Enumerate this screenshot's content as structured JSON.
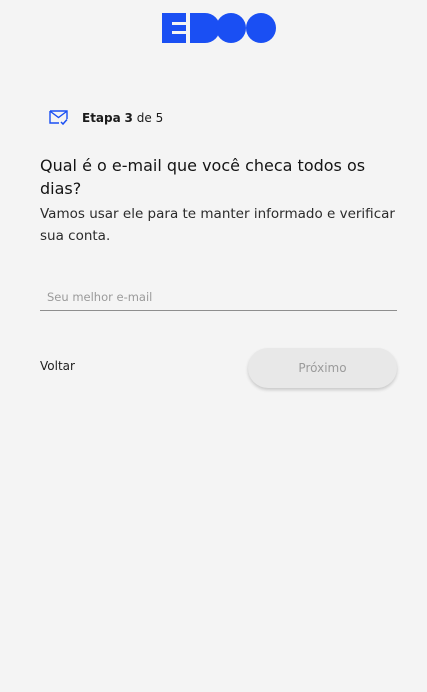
{
  "brand": {
    "logo_text": "EDOO",
    "color": "#1a4ff3"
  },
  "step": {
    "icon": "mail-check-icon",
    "prefix": "Etapa",
    "current": "3",
    "separator": "de",
    "total": "5"
  },
  "question": {
    "title": "Qual é o e-mail que você checa todos os dias?",
    "subtitle": "Vamos usar ele para te manter informado e verificar sua conta."
  },
  "email_input": {
    "value": "",
    "placeholder": "Seu melhor e-mail"
  },
  "actions": {
    "back_label": "Voltar",
    "next_label": "Próximo",
    "next_disabled": true
  }
}
